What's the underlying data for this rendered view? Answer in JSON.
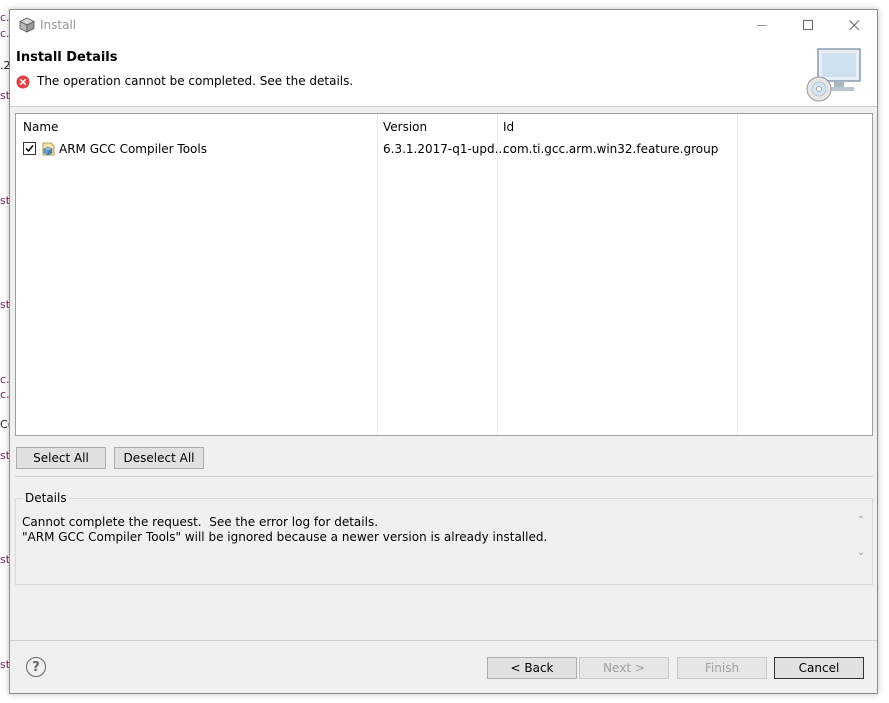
{
  "background_fragments": [
    "c.",
    "c.",
    ".2(",
    "st",
    "st",
    "st",
    "c.",
    "c.",
    "C(",
    "st",
    "st",
    "st"
  ],
  "window": {
    "title": "Install",
    "controls": {
      "minimize": "minimize-icon",
      "maximize": "maximize-icon",
      "close": "close-icon"
    }
  },
  "header": {
    "title": "Install Details",
    "message": "The operation cannot be completed.  See the details.",
    "error_color": "#e04040"
  },
  "table": {
    "columns": [
      "Name",
      "Version",
      "Id"
    ],
    "rows": [
      {
        "checked": true,
        "name": "ARM GCC Compiler Tools",
        "version": "6.3.1.2017-q1-upd...",
        "id": "com.ti.gcc.arm.win32.feature.group"
      }
    ]
  },
  "buttons": {
    "select_all": "Select All",
    "deselect_all": "Deselect All",
    "back": "< Back",
    "next": "Next >",
    "finish": "Finish",
    "cancel": "Cancel"
  },
  "details": {
    "legend": "Details",
    "text": "Cannot complete the request.  See the error log for details.\n\"ARM GCC Compiler Tools\" will be ignored because a newer version is already installed."
  }
}
